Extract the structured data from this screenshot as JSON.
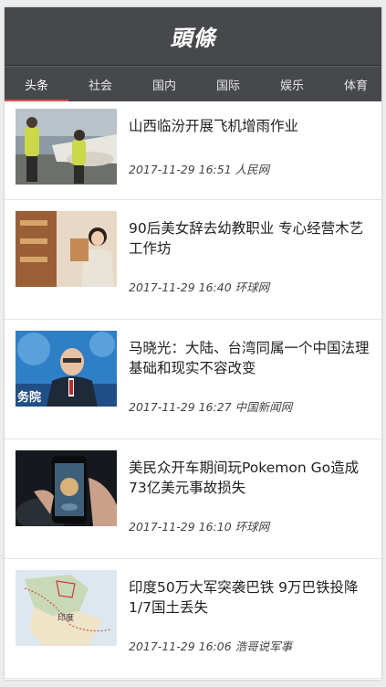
{
  "header": {
    "logo": "頭條"
  },
  "tabs": [
    {
      "label": "头条",
      "active": true
    },
    {
      "label": "社会",
      "active": false
    },
    {
      "label": "国内",
      "active": false
    },
    {
      "label": "国际",
      "active": false
    },
    {
      "label": "娱乐",
      "active": false
    },
    {
      "label": "体育",
      "active": false
    }
  ],
  "news": [
    {
      "title": "山西临汾开展飞机增雨作业",
      "time": "2017-11-29 16:51",
      "source": "人民网"
    },
    {
      "title": "90后美女辞去幼教职业 专心经营木艺工作坊",
      "time": "2017-11-29 16:40",
      "source": "环球网"
    },
    {
      "title": "马晓光：大陆、台湾同属一个中国法理基础和现实不容改变",
      "time": "2017-11-29 16:27",
      "source": "中国新闻网"
    },
    {
      "title": "美民众开车期间玩Pokemon Go造成73亿美元事故损失",
      "time": "2017-11-29 16:10",
      "source": "环球网"
    },
    {
      "title": "印度50万大军突袭巴铁 9万巴铁投降 1/7国土丢失",
      "time": "2017-11-29 16:06",
      "source": "浩哥说军事"
    }
  ],
  "thumb_labels": {
    "press_banner": "务院",
    "map_label": "印度"
  },
  "colors": {
    "header_bg": "#46484b",
    "active_underline": "#d9534f"
  }
}
